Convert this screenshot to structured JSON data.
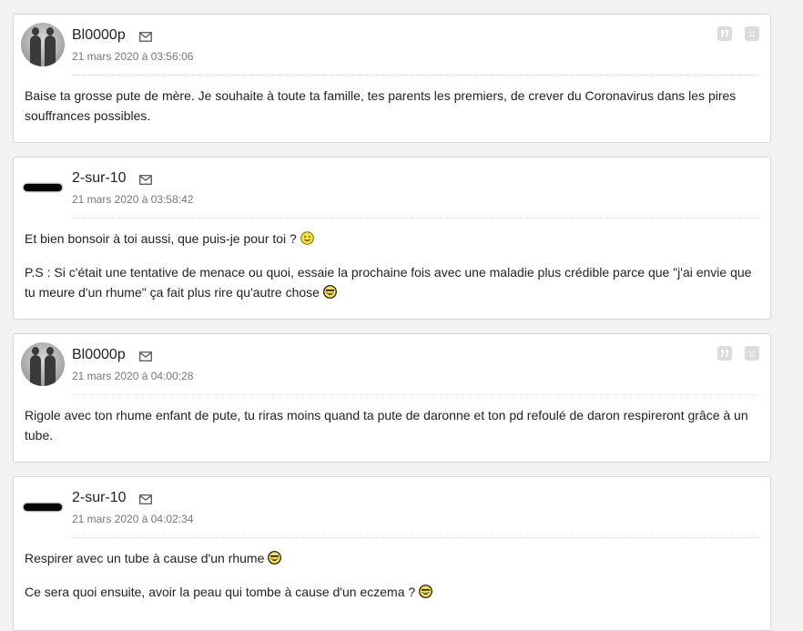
{
  "posts": [
    {
      "author": "Bl0000p",
      "avatar": "photo",
      "date": "21 mars 2020 à 03:56:06",
      "show_tools": true,
      "paragraphs": [
        {
          "text": "Baise ta grosse pute de mère. Je souhaite à toute ta famille, tes parents les premiers, de crever du Coronavirus dans les pires souffrances possibles.",
          "smiley": ""
        }
      ]
    },
    {
      "author": "2-sur-10",
      "avatar": "dash",
      "date": "21 mars 2020 à 03:58:42",
      "show_tools": false,
      "paragraphs": [
        {
          "text": "Et bien bonsoir à toi aussi, que puis-je pour toi ?",
          "smiley": "smile"
        },
        {
          "text": "P.S : Si c'était une tentative de menace ou quoi, essaie la prochaine fois avec une maladie plus crédible parce que \"j'ai envie que tu meure d'un rhume\" ça fait plus rire qu'autre chose",
          "smiley": "laugh"
        }
      ]
    },
    {
      "author": "Bl0000p",
      "avatar": "photo",
      "date": "21 mars 2020 à 04:00:28",
      "show_tools": true,
      "paragraphs": [
        {
          "text": "Rigole avec ton rhume enfant de pute, tu riras moins quand ta pute de daronne et ton pd refoulé de daron respireront grâce à un tube.",
          "smiley": ""
        }
      ]
    },
    {
      "author": "2-sur-10",
      "avatar": "dash",
      "date": "21 mars 2020 à 04:02:34",
      "show_tools": false,
      "paragraphs": [
        {
          "text": "Respirer avec un tube à cause d'un rhume",
          "smiley": "laugh"
        },
        {
          "text": "Ce sera quoi ensuite, avoir la peau qui tombe à cause d'un eczema ?",
          "smiley": "laugh"
        }
      ]
    }
  ],
  "icons": {
    "mail": "mail-icon",
    "quote": "quote-icon",
    "report": "report-icon",
    "smile": "smile-emoticon",
    "laugh": "laugh-emoticon"
  },
  "colors": {
    "smiley_yellow": "#f5e23a",
    "tool_gray": "#dcdcdc"
  }
}
